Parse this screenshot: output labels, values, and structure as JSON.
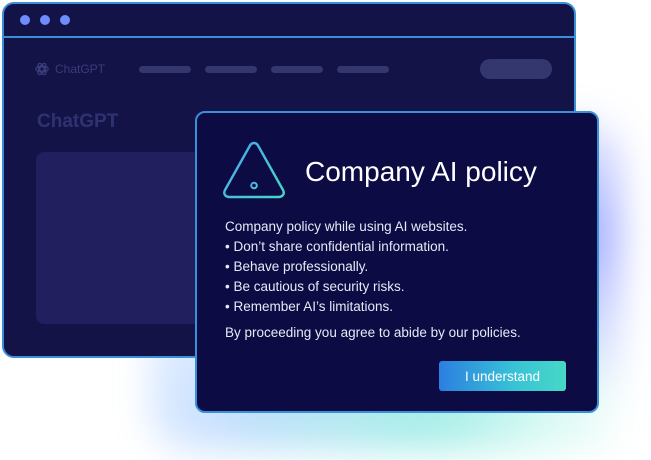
{
  "browser": {
    "window_dots": [
      "dot",
      "dot",
      "dot"
    ],
    "brand_label": "ChatGPT",
    "brand_icon": "openai-logo-icon",
    "nav_items": [
      "",
      "",
      "",
      ""
    ],
    "page_heading": "ChatGPT"
  },
  "modal": {
    "icon": "warning-triangle-icon",
    "title": "Company AI policy",
    "intro": "Company policy while using AI websites.",
    "bullets": [
      "• Don’t share confidential information.",
      "• Behave professionally.",
      "• Be cautious of security risks.",
      "• Remember AI’s limitations."
    ],
    "agreement": "By proceeding you agree to abide by our policies.",
    "button_label": "I understand"
  },
  "colors": {
    "browser_bg": "#141347",
    "modal_bg": "#0d0b43",
    "border": "#3a8fd6",
    "dot": "#6f8cff",
    "button_start": "#2c7fe0",
    "button_end": "#47d8c6"
  }
}
